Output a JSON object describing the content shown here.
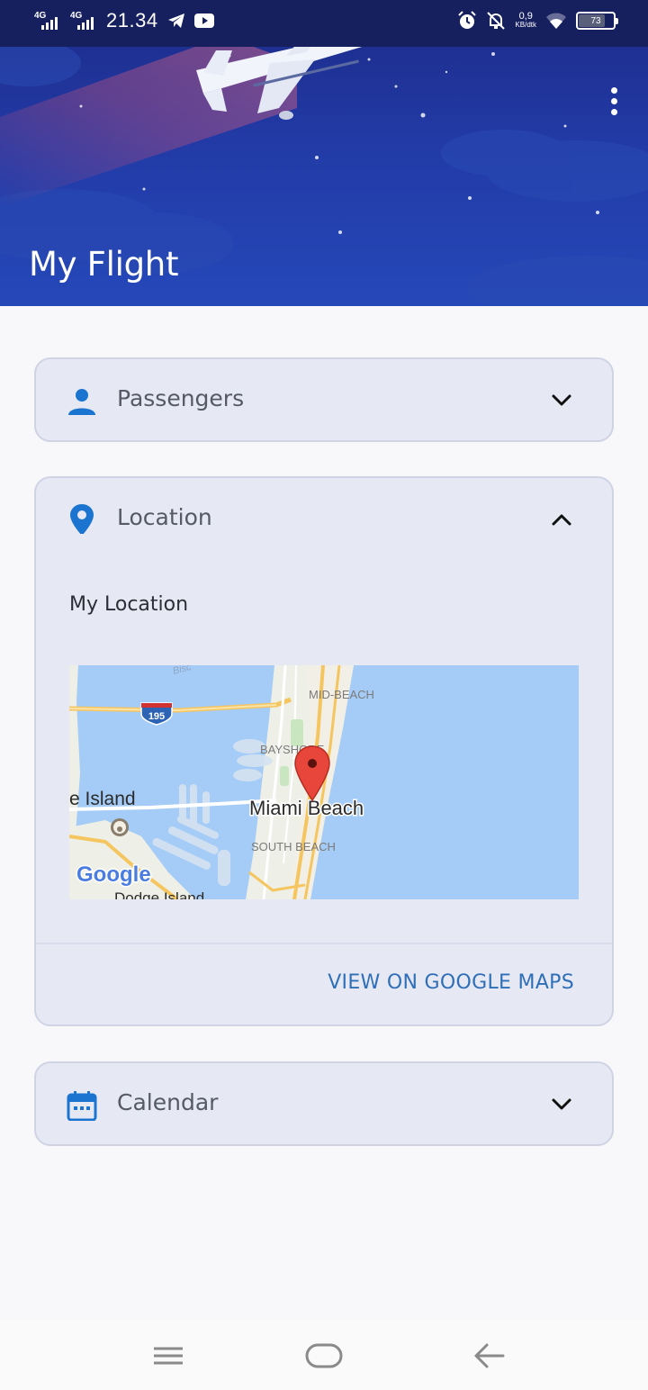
{
  "status_bar": {
    "network_1": "4G",
    "network_2": "4G",
    "time": "21.34",
    "speed_value": "0,9",
    "speed_unit": "KB/dtk",
    "battery": "73",
    "battery_level": 0.73,
    "icons": [
      "telegram-icon",
      "youtube-icon",
      "alarm-icon",
      "notifications-off-icon",
      "wifi-icon"
    ]
  },
  "header": {
    "title": "My Flight",
    "menu_icon": "more-vert-icon"
  },
  "cards": {
    "passengers": {
      "label": "Passengers",
      "icon": "person-icon",
      "state": "collapsed"
    },
    "location": {
      "label": "Location",
      "icon": "location-pin-icon",
      "state": "expanded",
      "subtitle": "My Location",
      "link_label": "VIEW ON GOOGLE MAPS",
      "map": {
        "labels": {
          "bisc": "Bisc",
          "highway": "195",
          "mid_beach": "MID-BEACH",
          "bayshore": "BAYSHORE",
          "island": "e Island",
          "miami_beach": "Miami Beach",
          "south_beach": "SOUTH BEACH",
          "dodge_island": "Dodge Island",
          "google": "Google"
        }
      }
    },
    "calendar": {
      "label": "Calendar",
      "icon": "calendar-icon",
      "state": "collapsed"
    }
  },
  "nav_bar": {
    "icons": [
      "menu-icon",
      "home-icon",
      "back-icon"
    ]
  },
  "colors": {
    "accent": "#1b75d0",
    "link": "#2f6fb8",
    "card_bg": "#e6e8f3",
    "header_bg": "#2240a8"
  }
}
